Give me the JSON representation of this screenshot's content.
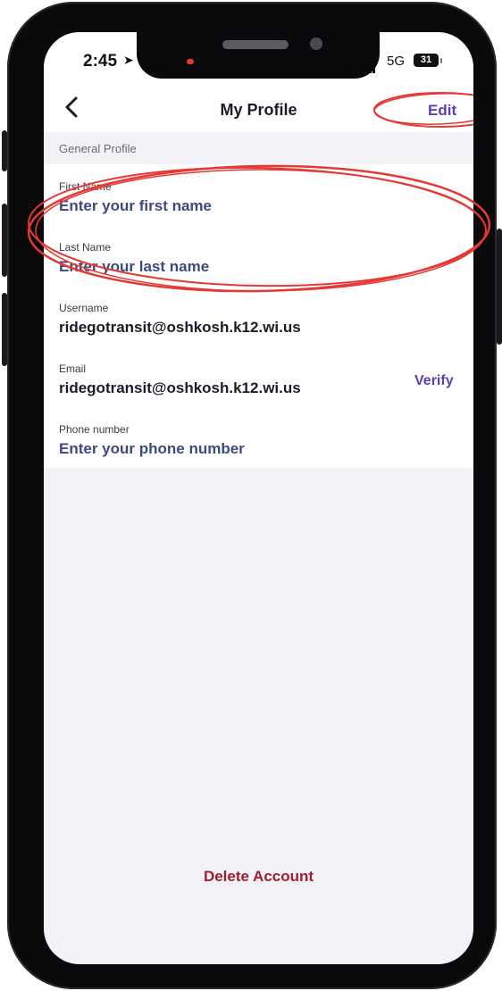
{
  "status_bar": {
    "time": "2:45",
    "network": "5G",
    "battery": "31"
  },
  "nav": {
    "title": "My Profile",
    "edit_label": "Edit"
  },
  "section": {
    "header": "General Profile"
  },
  "fields": {
    "first_name": {
      "label": "First Name",
      "placeholder": "Enter your first name"
    },
    "last_name": {
      "label": "Last Name",
      "placeholder": "Enter your last name"
    },
    "username": {
      "label": "Username",
      "value": "ridegotransit@oshkosh.k12.wi.us"
    },
    "email": {
      "label": "Email",
      "value": "ridegotransit@oshkosh.k12.wi.us",
      "verify_label": "Verify"
    },
    "phone": {
      "label": "Phone number",
      "placeholder": "Enter your phone number"
    }
  },
  "actions": {
    "delete_label": "Delete Account"
  },
  "colors": {
    "accent": "#5b3fb5",
    "danger": "#a31d33",
    "annotation": "#e53935"
  }
}
